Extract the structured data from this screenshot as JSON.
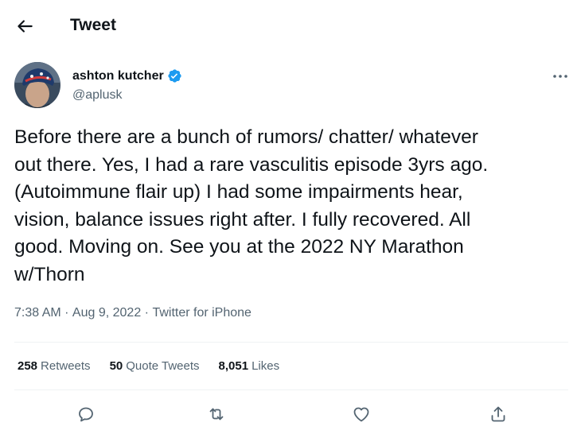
{
  "header": {
    "title": "Tweet",
    "back_icon": "arrow-left-icon"
  },
  "author": {
    "display_name": "ashton kutcher",
    "handle": "@aplusk",
    "verified": true,
    "verified_color": "#1d9bf0"
  },
  "tweet": {
    "text": "Before there are a bunch of rumors/ chatter/ whatever\nout there.  Yes, I had a rare vasculitis episode 3yrs ago.\n(Autoimmune flair up) I had some impairments hear,\nvision, balance issues right after. I fully recovered. All\ngood.  Moving on. See you at the 2022 NY Marathon\nw/Thorn",
    "time": "7:38 AM",
    "date": "Aug 9, 2022",
    "source": "Twitter for iPhone",
    "separator": " · "
  },
  "stats": [
    {
      "count": "258",
      "label": "Retweets"
    },
    {
      "count": "50",
      "label": "Quote Tweets"
    },
    {
      "count": "8,051",
      "label": "Likes"
    }
  ],
  "actions": [
    {
      "name": "reply",
      "icon": "reply-icon"
    },
    {
      "name": "retweet",
      "icon": "retweet-icon"
    },
    {
      "name": "like",
      "icon": "heart-icon"
    },
    {
      "name": "share",
      "icon": "share-icon"
    }
  ],
  "colors": {
    "text": "#0f1419",
    "secondary": "#536471",
    "divider": "#eff3f4",
    "accent": "#1d9bf0"
  }
}
